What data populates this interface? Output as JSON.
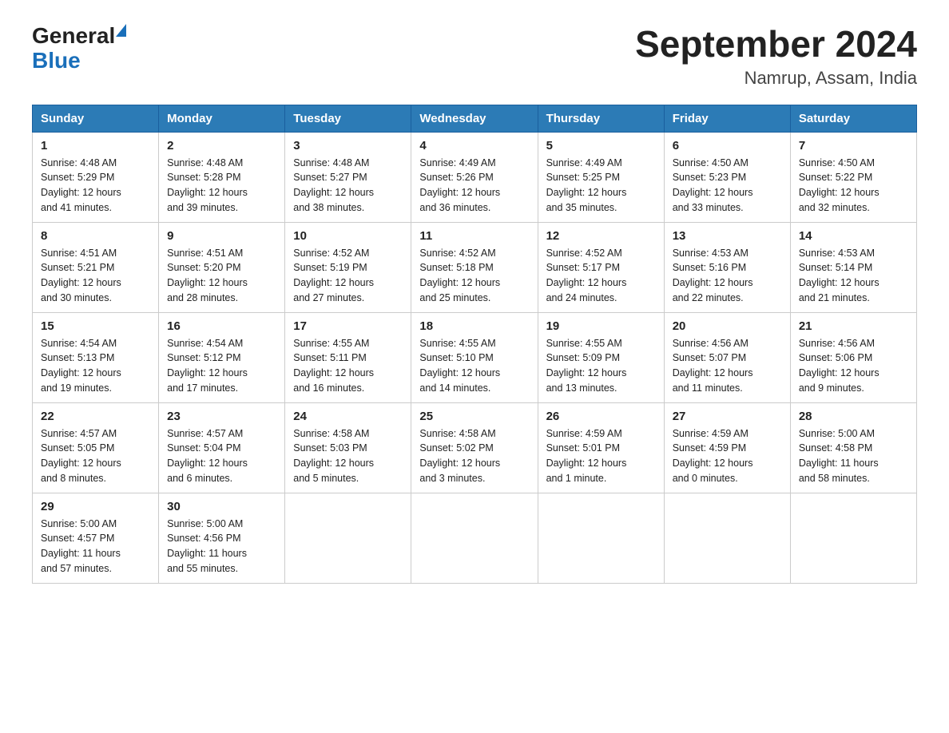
{
  "header": {
    "logo_general": "General",
    "logo_blue": "Blue",
    "month_year": "September 2024",
    "location": "Namrup, Assam, India"
  },
  "days_of_week": [
    "Sunday",
    "Monday",
    "Tuesday",
    "Wednesday",
    "Thursday",
    "Friday",
    "Saturday"
  ],
  "weeks": [
    [
      {
        "day": "1",
        "sunrise": "4:48 AM",
        "sunset": "5:29 PM",
        "daylight": "12 hours and 41 minutes."
      },
      {
        "day": "2",
        "sunrise": "4:48 AM",
        "sunset": "5:28 PM",
        "daylight": "12 hours and 39 minutes."
      },
      {
        "day": "3",
        "sunrise": "4:48 AM",
        "sunset": "5:27 PM",
        "daylight": "12 hours and 38 minutes."
      },
      {
        "day": "4",
        "sunrise": "4:49 AM",
        "sunset": "5:26 PM",
        "daylight": "12 hours and 36 minutes."
      },
      {
        "day": "5",
        "sunrise": "4:49 AM",
        "sunset": "5:25 PM",
        "daylight": "12 hours and 35 minutes."
      },
      {
        "day": "6",
        "sunrise": "4:50 AM",
        "sunset": "5:23 PM",
        "daylight": "12 hours and 33 minutes."
      },
      {
        "day": "7",
        "sunrise": "4:50 AM",
        "sunset": "5:22 PM",
        "daylight": "12 hours and 32 minutes."
      }
    ],
    [
      {
        "day": "8",
        "sunrise": "4:51 AM",
        "sunset": "5:21 PM",
        "daylight": "12 hours and 30 minutes."
      },
      {
        "day": "9",
        "sunrise": "4:51 AM",
        "sunset": "5:20 PM",
        "daylight": "12 hours and 28 minutes."
      },
      {
        "day": "10",
        "sunrise": "4:52 AM",
        "sunset": "5:19 PM",
        "daylight": "12 hours and 27 minutes."
      },
      {
        "day": "11",
        "sunrise": "4:52 AM",
        "sunset": "5:18 PM",
        "daylight": "12 hours and 25 minutes."
      },
      {
        "day": "12",
        "sunrise": "4:52 AM",
        "sunset": "5:17 PM",
        "daylight": "12 hours and 24 minutes."
      },
      {
        "day": "13",
        "sunrise": "4:53 AM",
        "sunset": "5:16 PM",
        "daylight": "12 hours and 22 minutes."
      },
      {
        "day": "14",
        "sunrise": "4:53 AM",
        "sunset": "5:14 PM",
        "daylight": "12 hours and 21 minutes."
      }
    ],
    [
      {
        "day": "15",
        "sunrise": "4:54 AM",
        "sunset": "5:13 PM",
        "daylight": "12 hours and 19 minutes."
      },
      {
        "day": "16",
        "sunrise": "4:54 AM",
        "sunset": "5:12 PM",
        "daylight": "12 hours and 17 minutes."
      },
      {
        "day": "17",
        "sunrise": "4:55 AM",
        "sunset": "5:11 PM",
        "daylight": "12 hours and 16 minutes."
      },
      {
        "day": "18",
        "sunrise": "4:55 AM",
        "sunset": "5:10 PM",
        "daylight": "12 hours and 14 minutes."
      },
      {
        "day": "19",
        "sunrise": "4:55 AM",
        "sunset": "5:09 PM",
        "daylight": "12 hours and 13 minutes."
      },
      {
        "day": "20",
        "sunrise": "4:56 AM",
        "sunset": "5:07 PM",
        "daylight": "12 hours and 11 minutes."
      },
      {
        "day": "21",
        "sunrise": "4:56 AM",
        "sunset": "5:06 PM",
        "daylight": "12 hours and 9 minutes."
      }
    ],
    [
      {
        "day": "22",
        "sunrise": "4:57 AM",
        "sunset": "5:05 PM",
        "daylight": "12 hours and 8 minutes."
      },
      {
        "day": "23",
        "sunrise": "4:57 AM",
        "sunset": "5:04 PM",
        "daylight": "12 hours and 6 minutes."
      },
      {
        "day": "24",
        "sunrise": "4:58 AM",
        "sunset": "5:03 PM",
        "daylight": "12 hours and 5 minutes."
      },
      {
        "day": "25",
        "sunrise": "4:58 AM",
        "sunset": "5:02 PM",
        "daylight": "12 hours and 3 minutes."
      },
      {
        "day": "26",
        "sunrise": "4:59 AM",
        "sunset": "5:01 PM",
        "daylight": "12 hours and 1 minute."
      },
      {
        "day": "27",
        "sunrise": "4:59 AM",
        "sunset": "4:59 PM",
        "daylight": "12 hours and 0 minutes."
      },
      {
        "day": "28",
        "sunrise": "5:00 AM",
        "sunset": "4:58 PM",
        "daylight": "11 hours and 58 minutes."
      }
    ],
    [
      {
        "day": "29",
        "sunrise": "5:00 AM",
        "sunset": "4:57 PM",
        "daylight": "11 hours and 57 minutes."
      },
      {
        "day": "30",
        "sunrise": "5:00 AM",
        "sunset": "4:56 PM",
        "daylight": "11 hours and 55 minutes."
      },
      null,
      null,
      null,
      null,
      null
    ]
  ],
  "labels": {
    "sunrise": "Sunrise:",
    "sunset": "Sunset:",
    "daylight": "Daylight:"
  }
}
